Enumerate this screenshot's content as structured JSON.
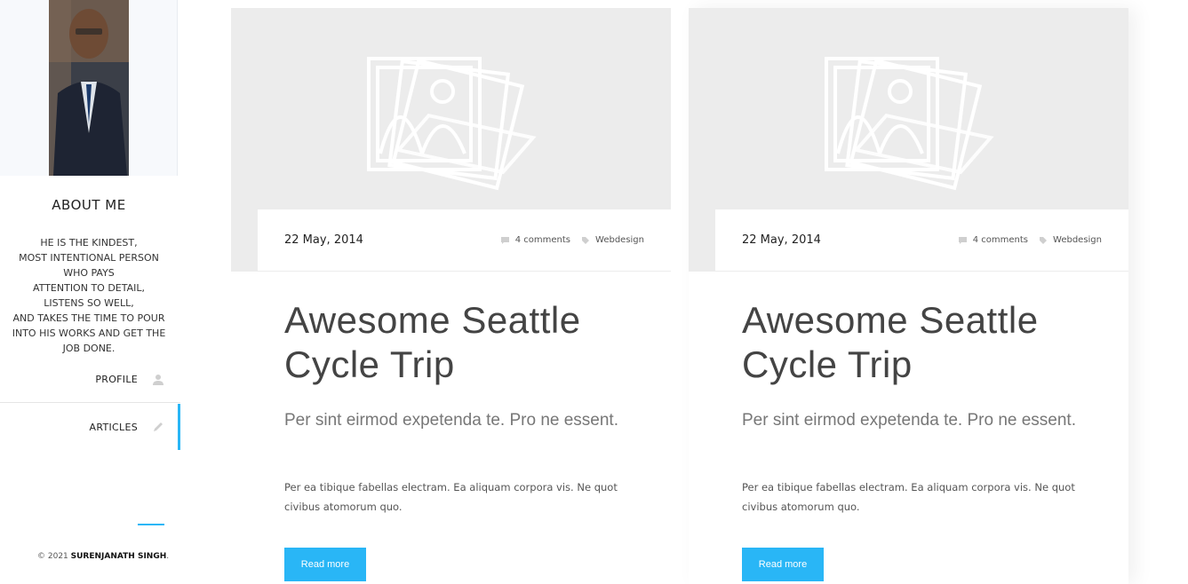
{
  "sidebar": {
    "about_title": "ABOUT ME",
    "about_lines": [
      "HE IS THE KINDEST,",
      "MOST INTENTIONAL PERSON",
      "WHO PAYS",
      "ATTENTION TO DETAIL,",
      "LISTENS SO WELL,",
      "AND TAKES THE TIME TO POUR",
      "INTO HIS WORKS AND GET THE",
      "JOB DONE."
    ],
    "nav": [
      {
        "label": "PROFILE",
        "icon": "user-icon"
      },
      {
        "label": "ARTICLES",
        "icon": "pencil-icon",
        "active": true
      }
    ],
    "copyright_prefix": "© 2021",
    "copyright_name": "SURENJANATH SINGH",
    "copyright_suffix": "."
  },
  "cards": [
    {
      "date": "22 May, 2014",
      "comments": "4 comments",
      "category": "Webdesign",
      "title_line1": "Awesome Seattle",
      "title_line2": "Cycle Trip",
      "subtitle": "Per sint eirmod expetenda te. Pro ne essent.",
      "text": "Per ea tibique fabellas electram. Ea aliquam corpora vis. Ne quot civibus atomorum quo.",
      "button": "Read more"
    },
    {
      "date": "22 May, 2014",
      "comments": "4 comments",
      "category": "Webdesign",
      "title_line1": "Awesome Seattle",
      "title_line2": "Cycle Trip",
      "subtitle": "Per sint eirmod expetenda te. Pro ne essent.",
      "text": "Per ea tibique fabellas electram. Ea aliquam corpora vis. Ne quot civibus atomorum quo.",
      "button": "Read more"
    }
  ],
  "colors": {
    "accent": "#29b6f6",
    "image_placeholder": "#ececec"
  }
}
